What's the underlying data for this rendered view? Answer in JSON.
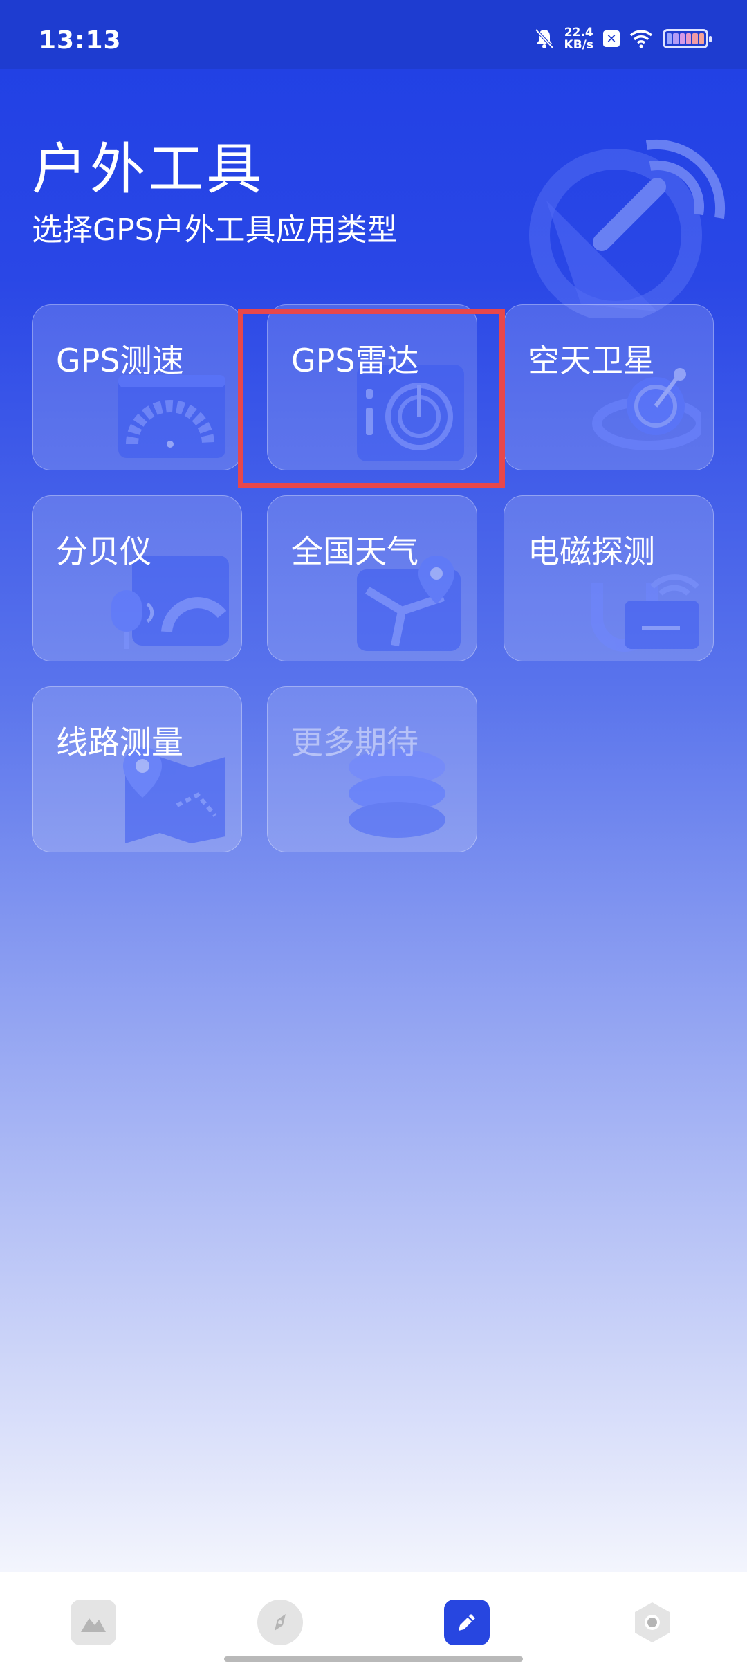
{
  "status_bar": {
    "time": "13:13",
    "net_speed_value": "22.4",
    "net_speed_unit": "KB/s",
    "icons": [
      "bell-off-icon",
      "app-notification-icon",
      "wifi-icon",
      "battery-icon"
    ]
  },
  "header": {
    "title": "户外工具",
    "subtitle": "选择GPS户外工具应用类型"
  },
  "tiles": [
    {
      "label": "GPS测速",
      "icon": "speedometer-icon"
    },
    {
      "label": "GPS雷达",
      "icon": "radar-icon",
      "highlighted": true
    },
    {
      "label": "空天卫星",
      "icon": "satellite-planet-icon"
    },
    {
      "label": "分贝仪",
      "icon": "decibel-meter-icon"
    },
    {
      "label": "全国天气",
      "icon": "weather-map-icon"
    },
    {
      "label": "电磁探测",
      "icon": "electromagnetic-detector-icon"
    },
    {
      "label": "线路测量",
      "icon": "route-map-icon"
    },
    {
      "label": "更多期待",
      "icon": "stack-icon",
      "disabled": true
    }
  ],
  "bottom_nav": {
    "items": [
      {
        "icon": "mountain-icon",
        "active": false
      },
      {
        "icon": "compass-icon",
        "active": false
      },
      {
        "icon": "pencil-icon",
        "active": true
      },
      {
        "icon": "settings-icon",
        "active": false
      }
    ]
  },
  "colors": {
    "accent": "#2746e0",
    "highlight_box": "#e8474b",
    "status_bar": "#1e3cd0"
  }
}
